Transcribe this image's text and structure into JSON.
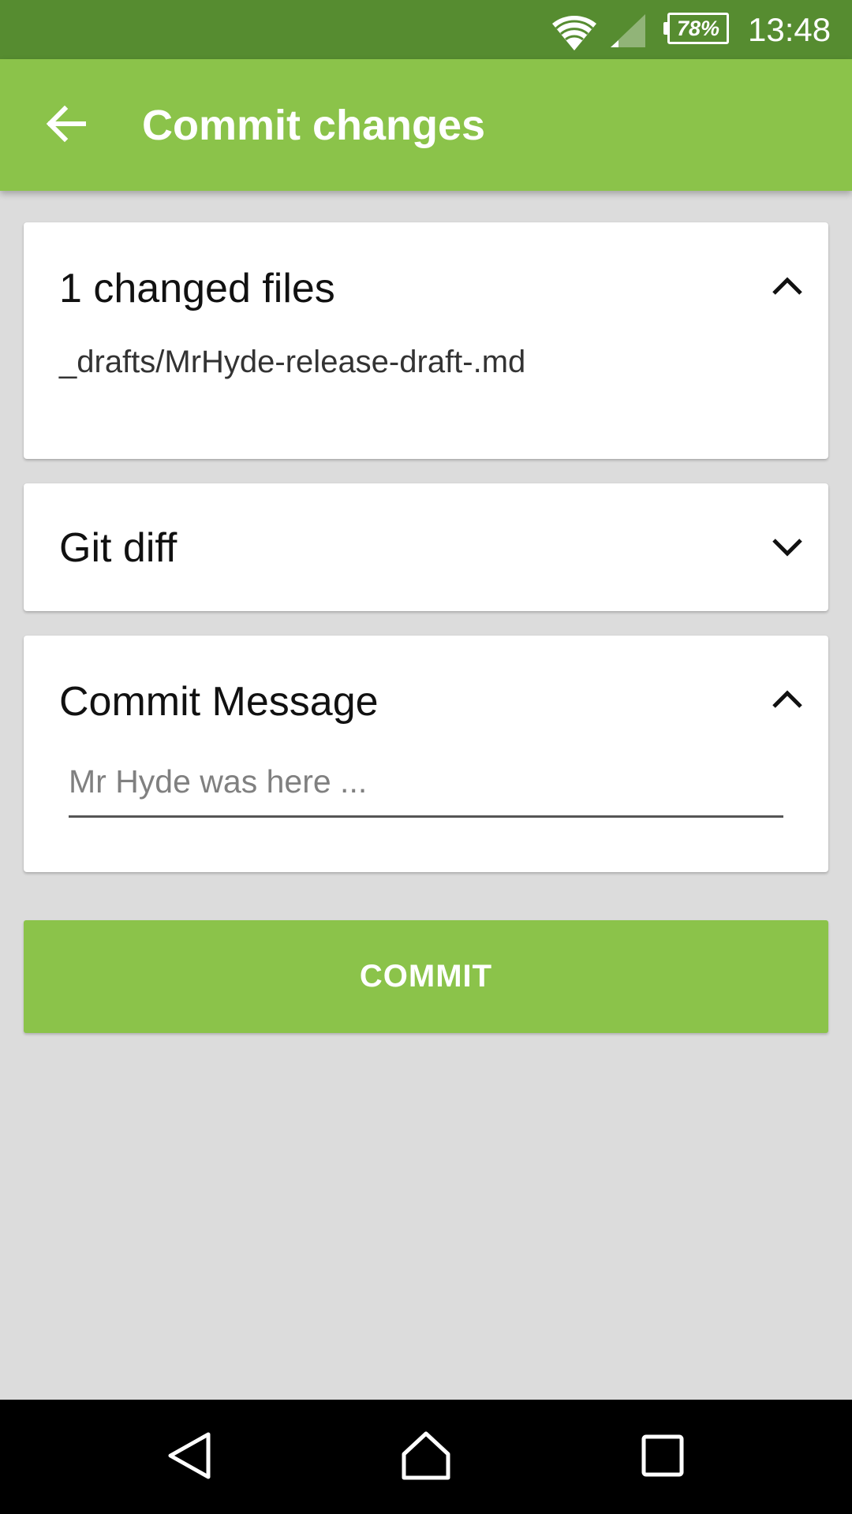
{
  "status_bar": {
    "battery": "78%",
    "time": "13:48",
    "icons": [
      "wifi-icon",
      "cell-signal-icon",
      "battery-icon"
    ]
  },
  "app_bar": {
    "title": "Commit changes",
    "back_icon": "arrow-back-icon"
  },
  "changed_files_card": {
    "title": "1 changed files",
    "expanded": true,
    "files": [
      "_drafts/MrHyde-release-draft-.md"
    ]
  },
  "git_diff_card": {
    "title": "Git diff",
    "expanded": false
  },
  "commit_message_card": {
    "title": "Commit Message",
    "expanded": true,
    "input": {
      "value": "",
      "placeholder": "Mr Hyde was here ..."
    }
  },
  "commit_button": {
    "label": "COMMIT"
  },
  "nav_bar": {
    "icons": [
      "back-nav-icon",
      "home-nav-icon",
      "recents-nav-icon"
    ]
  },
  "colors": {
    "status_bar": "#568c30",
    "primary": "#8bc34a",
    "background": "#dcdcdc",
    "card": "#ffffff"
  }
}
